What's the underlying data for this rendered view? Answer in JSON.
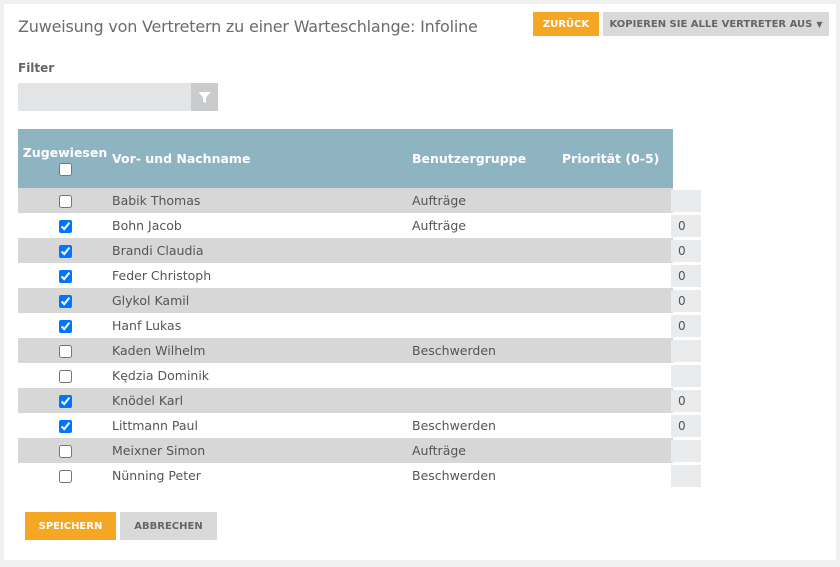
{
  "header": {
    "title": "Zuweisung von Vertretern zu einer Warteschlange: Infoline",
    "back_label": "ZURÜCK",
    "copy_label": "KOPIEREN SIE ALLE VERTRETER AUS"
  },
  "filter": {
    "label": "Filter",
    "value": ""
  },
  "table": {
    "headers": {
      "assigned": "Zugewiesen",
      "name": "Vor- und Nachname",
      "group": "Benutzergruppe",
      "priority": "Priorität (0-5)"
    },
    "rows": [
      {
        "name": "Babik Thomas",
        "group": "Aufträge",
        "assigned": false,
        "priority": ""
      },
      {
        "name": "Bohn Jacob",
        "group": "Aufträge",
        "assigned": true,
        "priority": "0"
      },
      {
        "name": "Brandi Claudia",
        "group": "",
        "assigned": true,
        "priority": "0"
      },
      {
        "name": "Feder Christoph",
        "group": "",
        "assigned": true,
        "priority": "0"
      },
      {
        "name": "Glykol Kamil",
        "group": "",
        "assigned": true,
        "priority": "0"
      },
      {
        "name": "Hanf Lukas",
        "group": "",
        "assigned": true,
        "priority": "0"
      },
      {
        "name": "Kaden Wilhelm",
        "group": "Beschwerden",
        "assigned": false,
        "priority": ""
      },
      {
        "name": "Kędzia Dominik",
        "group": "",
        "assigned": false,
        "priority": ""
      },
      {
        "name": "Knödel Karl",
        "group": "",
        "assigned": true,
        "priority": "0"
      },
      {
        "name": "Littmann Paul",
        "group": "Beschwerden",
        "assigned": true,
        "priority": "0"
      },
      {
        "name": "Meixner Simon",
        "group": "Aufträge",
        "assigned": false,
        "priority": ""
      },
      {
        "name": "Nünning Peter",
        "group": "Beschwerden",
        "assigned": false,
        "priority": ""
      }
    ]
  },
  "footer": {
    "save_label": "SPEICHERN",
    "cancel_label": "ABBRECHEN"
  },
  "colors": {
    "accent": "#f5a623",
    "table_header": "#8fb4c1",
    "row_stripe": "#d7d7d7"
  },
  "icons": {
    "filter": "filter-funnel-icon",
    "dropdown": "caret-down-icon"
  }
}
